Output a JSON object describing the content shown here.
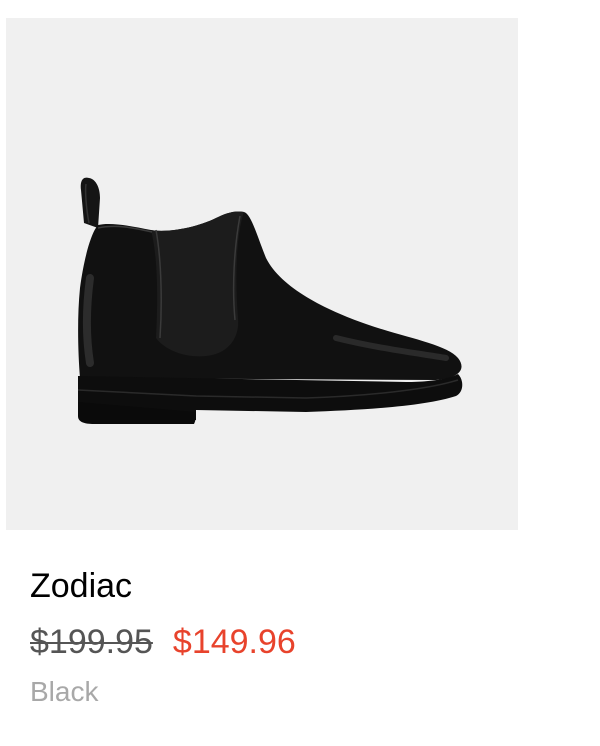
{
  "product": {
    "name": "Zodiac",
    "price_original": "$199.95",
    "price_sale": "$149.96",
    "color": "Black",
    "image_subject": "black-leather-chelsea-boot"
  },
  "colors": {
    "image_background": "#f0f0f0",
    "sale_price": "#e8432c",
    "original_price": "#555555",
    "variant_text": "#a8a8a8",
    "name_text": "#000000"
  }
}
